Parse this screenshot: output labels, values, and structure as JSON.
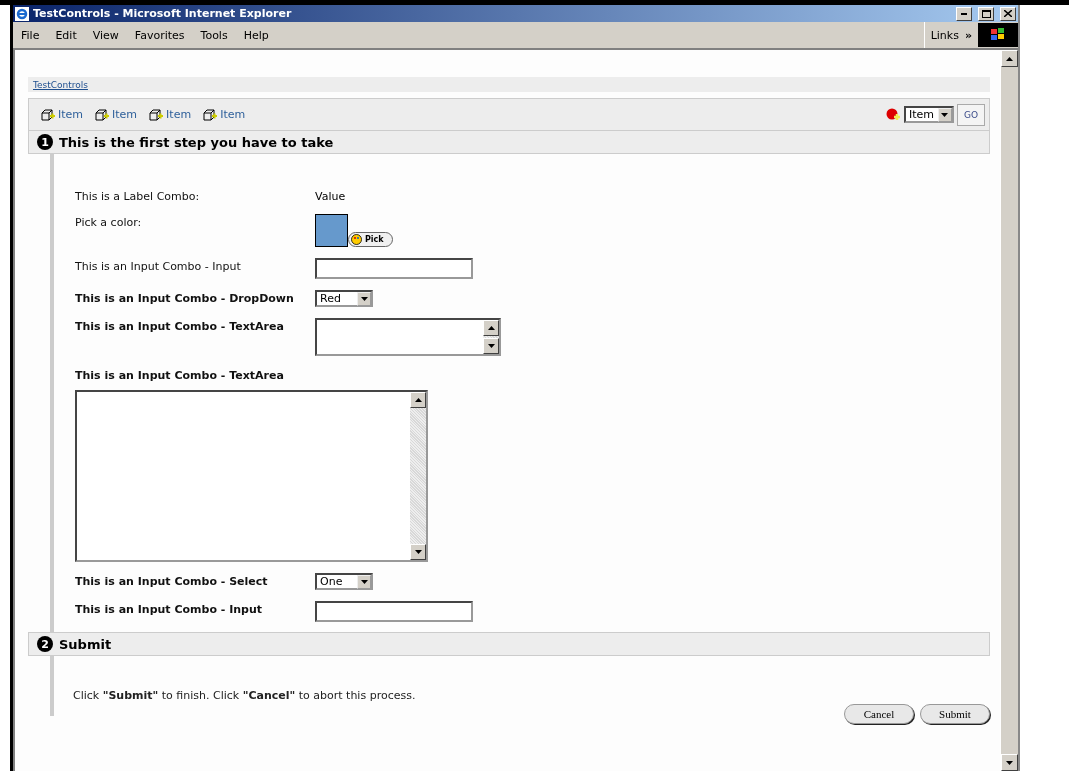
{
  "window": {
    "title": "TestControls - Microsoft Internet Explorer"
  },
  "menu": [
    "File",
    "Edit",
    "View",
    "Favorites",
    "Tools",
    "Help"
  ],
  "links": {
    "label": "Links",
    "chevron": "»"
  },
  "breadcrumb": "TestControls",
  "toolbar": {
    "items": [
      "Item",
      "Item",
      "Item",
      "Item"
    ],
    "select": "Item",
    "go": "GO"
  },
  "steps": [
    {
      "number": "1",
      "title": "This is the first step you have to take",
      "rows": [
        {
          "kind": "label",
          "label": "This is a Label Combo:",
          "bold": false,
          "value": "Value"
        },
        {
          "kind": "color",
          "label": "Pick a color:",
          "bold": false,
          "color": "#6699cc",
          "button": "Pick"
        },
        {
          "kind": "input",
          "label": "This is an Input Combo - Input",
          "bold": false
        },
        {
          "kind": "dropdown",
          "label": "This is an Input Combo - DropDown",
          "bold": true,
          "value": "Red"
        },
        {
          "kind": "textarea",
          "label": "This is an Input Combo - TextArea",
          "bold": true
        },
        {
          "kind": "bigtextarea",
          "label": "This is an Input Combo - TextArea",
          "bold": true
        },
        {
          "kind": "dropdown",
          "label": "This is an Input Combo - Select",
          "bold": true,
          "value": "One"
        },
        {
          "kind": "input",
          "label": "This is an Input Combo - Input",
          "bold": true
        }
      ]
    },
    {
      "number": "2",
      "title": "Submit",
      "message": "Click **\"Submit\"** to finish. Click **\"Cancel\"** to abort this process."
    }
  ],
  "buttons": [
    "Cancel",
    "Submit"
  ]
}
